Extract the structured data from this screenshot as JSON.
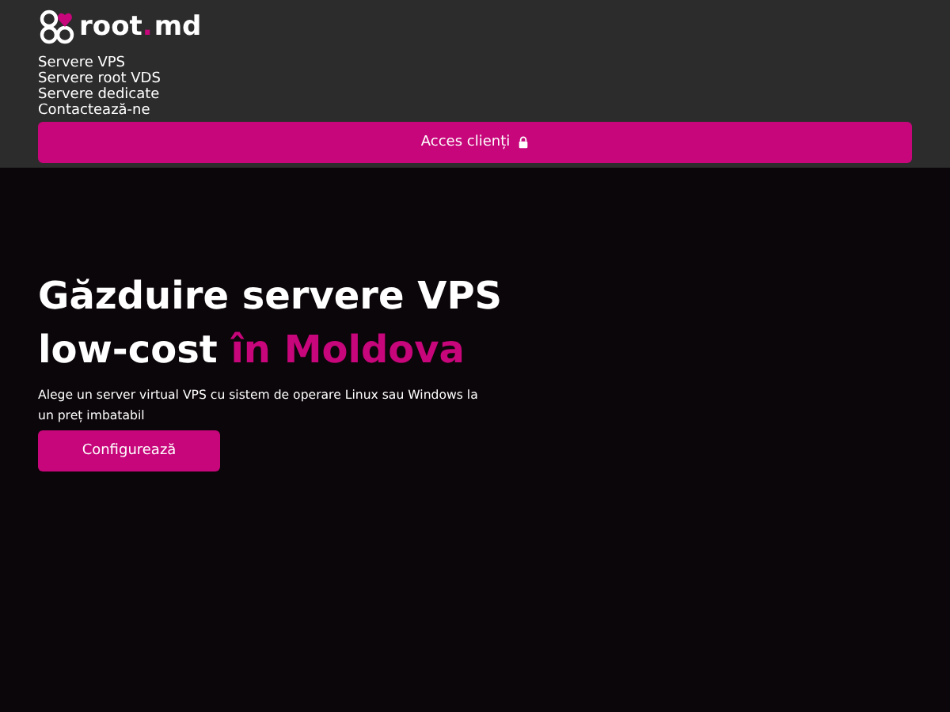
{
  "logo": {
    "name": "root",
    "dot": ".",
    "suffix": "md"
  },
  "nav": [
    {
      "label": "Servere VPS"
    },
    {
      "label": "Servere root VDS"
    },
    {
      "label": "Servere dedicate"
    },
    {
      "label": "Contactează-ne"
    }
  ],
  "client_button": {
    "label": "Acces clienți"
  },
  "hero": {
    "title": "Găzduire servere VPS low-cost",
    "title_highlight": "în Moldova",
    "subtitle": "Alege un server virtual VPS cu sistem de operare Linux sau Windows la un preț imbatabil",
    "button": "Configurează"
  }
}
